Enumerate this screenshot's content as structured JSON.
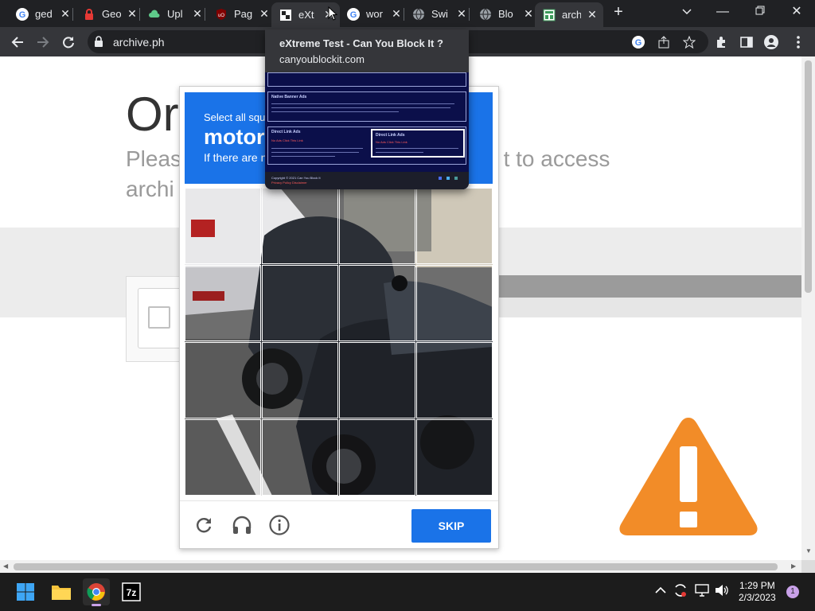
{
  "browser": {
    "tabs": [
      {
        "title": "ged",
        "icon": "google-icon"
      },
      {
        "title": "Geo",
        "icon": "lock-icon"
      },
      {
        "title": "Upl",
        "icon": "cloud-icon"
      },
      {
        "title": "Pag",
        "icon": "ublock-icon"
      },
      {
        "title": "eXt",
        "icon": "shield-icon",
        "active": true
      },
      {
        "title": "wor",
        "icon": "google-icon"
      },
      {
        "title": "Swi",
        "icon": "globe-icon"
      },
      {
        "title": "Blo",
        "icon": "globe-icon"
      },
      {
        "title": "arch",
        "icon": "archive-icon",
        "active": true
      }
    ],
    "url": "archive.ph"
  },
  "hover_preview": {
    "title": "eXtreme Test - Can You Block It ?",
    "url": "canyoublockit.com",
    "thumb_sections": [
      "Native Banner Ads",
      "Direct Link Ads",
      "Direct Link Ads"
    ],
    "thumb_links": [
      "No Ads Click This Link",
      "No Ads Click This Link"
    ],
    "thumb_footer": "Copyright © 2021 Can You Block It",
    "thumb_footer_link": "Privacy Policy Disclaimer"
  },
  "page": {
    "heading": "Or",
    "message": "Pleas                                                    t to access archi"
  },
  "challenge": {
    "instruction": "Select all squa",
    "target": "motor",
    "hint": "If there are n",
    "skip_label": "SKIP"
  },
  "taskbar": {
    "time": "1:29 PM",
    "date": "2/3/2023",
    "notification_count": "1"
  },
  "colors": {
    "accent": "#1a73e8",
    "warning": "#f28c28",
    "tab_bar": "#202124"
  }
}
